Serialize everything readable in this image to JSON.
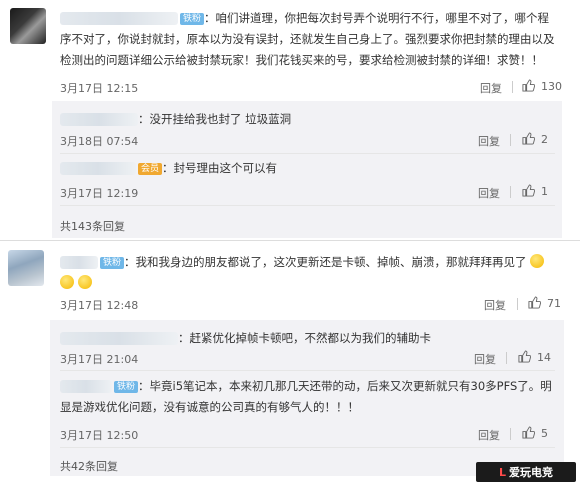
{
  "badges": {
    "fan": "铁粉",
    "gold": "会员"
  },
  "comment1": {
    "text": "：咱们讲道理，你把每次封号弄个说明行不行，哪里不对了，哪个程序不对了，你说封就封，原本以为没有误封，还就发生自己身上了。强烈要求你把封禁的理由以及检测出的问题详细公示给被封禁玩家！我们花钱买来的号，要求给检测被封禁的详细！求赞！！",
    "time": "3月17日 12:15",
    "reply": "回复",
    "likes": "130",
    "replies": [
      {
        "text": "：没开挂给我也封了 垃圾蓝洞",
        "time": "3月18日 07:54",
        "reply": "回复",
        "likes": "2"
      },
      {
        "text": "：封号理由这个可以有",
        "time": "3月17日 12:19",
        "reply": "回复",
        "likes": "1"
      }
    ],
    "more": "共143条回复"
  },
  "comment2": {
    "text": "：我和我身边的朋友都说了，这次更新还是卡顿、掉帧、崩溃，那就拜拜再见了",
    "time": "3月17日 12:48",
    "reply": "回复",
    "likes": "71",
    "replies": [
      {
        "text": "：赶紧优化掉帧卡顿吧，不然都以为我们的辅助卡",
        "time": "3月17日 21:04",
        "reply": "回复",
        "likes": "14"
      },
      {
        "text": "：毕竟i5笔记本，本来初几那几天还带的动，后来又次更新就只有30多PFS了。明显是游戏优化问题，没有诚意的公司真的有够气人的！！！",
        "time": "3月17日 12:50",
        "reply": "回复",
        "likes": "5"
      }
    ],
    "more": "共42条回复"
  },
  "watermark": {
    "logo": "L",
    "text": "爱玩电竞"
  }
}
